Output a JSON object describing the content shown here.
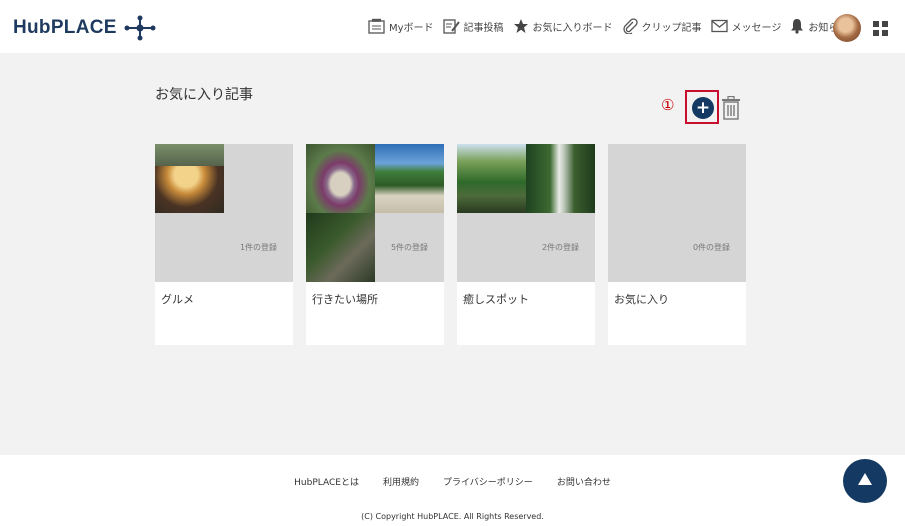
{
  "header": {
    "logo": "HubPLACE",
    "nav": [
      {
        "label": "Myボード",
        "icon": "board-icon"
      },
      {
        "label": "記事投稿",
        "icon": "edit-icon"
      },
      {
        "label": "お気に入りボード",
        "icon": "star-icon"
      },
      {
        "label": "クリップ記事",
        "icon": "clip-icon"
      },
      {
        "label": "メッセージ",
        "icon": "mail-icon"
      },
      {
        "label": "お知らせ",
        "icon": "bell-icon"
      }
    ]
  },
  "main": {
    "title": "お気に入り記事",
    "step_marker": "①",
    "add_label": "+",
    "boards": [
      {
        "name": "グルメ",
        "count": "1件の登録"
      },
      {
        "name": "行きたい場所",
        "count": "5件の登録"
      },
      {
        "name": "癒しスポット",
        "count": "2件の登録"
      },
      {
        "name": "お気に入り",
        "count": "0件の登録"
      }
    ]
  },
  "footer": {
    "links": [
      "HubPLACEとは",
      "利用規約",
      "プライバシーポリシー",
      "お問い合わせ"
    ],
    "copyright": "(C) Copyright HubPLACE. All Rights Reserved."
  },
  "colors": {
    "brand": "#143a63",
    "highlight": "#c8102e",
    "background": "#f2f2f2"
  }
}
